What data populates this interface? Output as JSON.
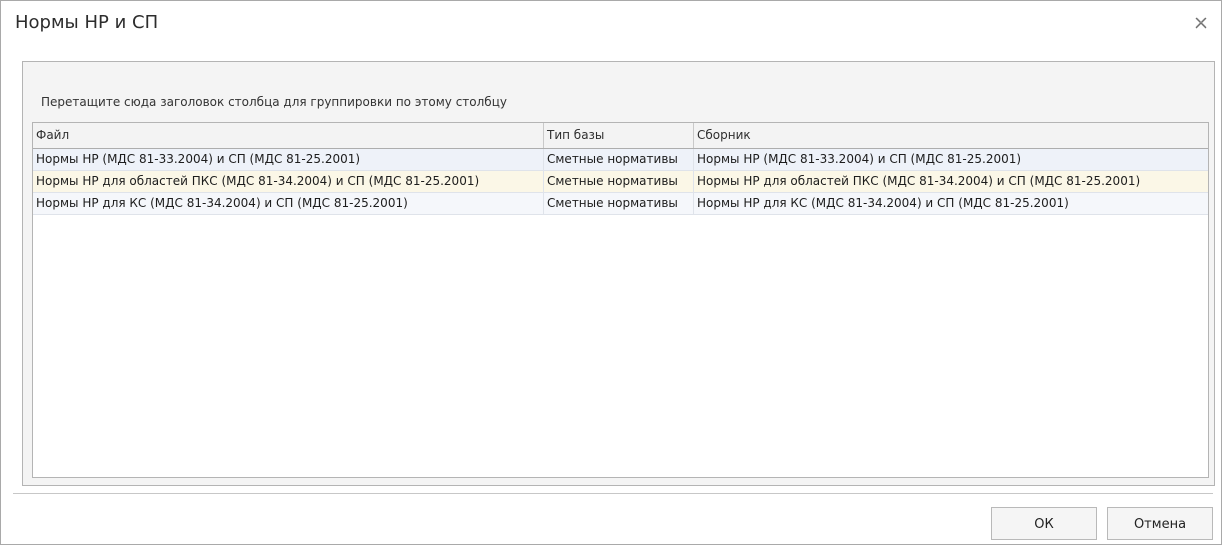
{
  "window": {
    "title": "Нормы НР и СП",
    "close_icon": "close-icon"
  },
  "grid": {
    "group_hint": "Перетащите сюда заголовок столбца для группировки по этому столбцу",
    "columns": [
      "Файл",
      "Тип базы",
      "Сборник"
    ],
    "rows": [
      [
        "Нормы НР (МДС 81-33.2004) и СП (МДС 81-25.2001)",
        "Сметные нормативы",
        "Нормы НР (МДС 81-33.2004) и СП (МДС 81-25.2001)"
      ],
      [
        "Нормы НР для областей ПКС (МДС 81-34.2004) и СП (МДС 81-25.2001)",
        "Сметные нормативы",
        "Нормы НР для областей ПКС (МДС 81-34.2004) и СП (МДС 81-25.2001)"
      ],
      [
        "Нормы НР для КС (МДС 81-34.2004) и СП (МДС 81-25.2001)",
        "Сметные нормативы",
        "Нормы НР для КС (МДС 81-34.2004) и СП (МДС 81-25.2001)"
      ]
    ]
  },
  "buttons": {
    "ok": "ОК",
    "cancel": "Отмена"
  }
}
